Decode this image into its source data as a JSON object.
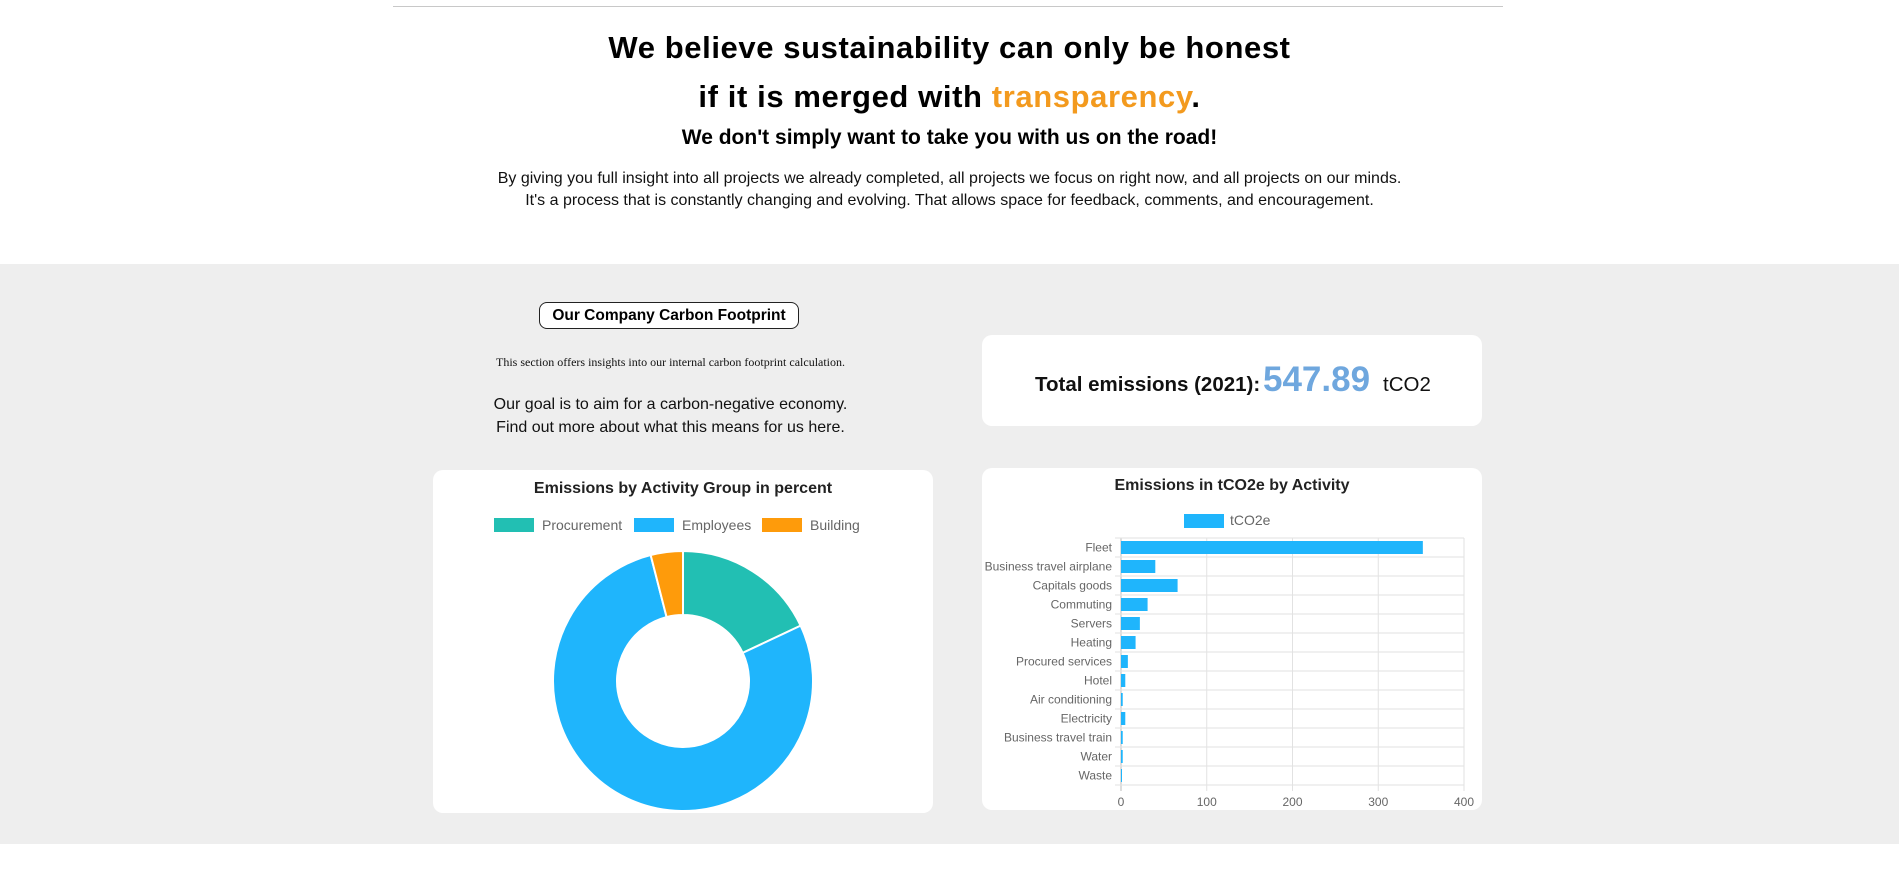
{
  "header": {
    "line1": "We believe sustainability can only be honest",
    "line2_prefix": "if it is merged with ",
    "line2_accent": "transparency",
    "line2_suffix": ".",
    "subhead": "We don't simply want to take you with us on the road!",
    "intro_line1": "By giving you full insight into all projects we already completed, all projects we focus on right now, and all projects on our minds.",
    "intro_line2": "It's a process that is constantly changing and evolving. That allows space for feedback, comments, and encouragement."
  },
  "footprint": {
    "pill_label": "Our Company Carbon Footprint",
    "note": "This section offers insights into our internal carbon footprint calculation.",
    "goal_line1": "Our goal is to aim for a carbon-negative economy.",
    "goal_line2_prefix": "Find out more about what this means for us ",
    "goal_link": "here",
    "goal_line2_suffix": "."
  },
  "total": {
    "label": "Total emissions (2021):",
    "value": "547.89",
    "unit": "tCO2"
  },
  "colors": {
    "accent": "#f39a1e",
    "teal": "#22bfb3",
    "blue": "#1fb5fc",
    "orange": "#fe9b0b",
    "total_value": "#6fa7de"
  },
  "chart_data": [
    {
      "type": "pie",
      "variant": "doughnut",
      "title": "Emissions by Activity Group in percent",
      "categories": [
        "Procurement",
        "Employees",
        "Building"
      ],
      "values": [
        18,
        78,
        4
      ],
      "legend": "top"
    },
    {
      "type": "bar",
      "orientation": "horizontal",
      "title": "Emissions in tCO2e by Activity",
      "legend": "top",
      "series": [
        {
          "name": "tCO2e",
          "values": [
            352,
            40,
            66,
            31,
            22,
            17,
            8,
            5,
            2,
            5,
            2,
            2,
            1
          ]
        }
      ],
      "categories": [
        "Fleet",
        "Business travel airplane",
        "Capitals goods",
        "Commuting",
        "Servers",
        "Heating",
        "Procured services",
        "Hotel",
        "Air conditioning",
        "Electricity",
        "Business travel train",
        "Water",
        "Waste"
      ],
      "xlim": [
        0,
        400
      ],
      "xticks": [
        "0",
        "100",
        "200",
        "300",
        "400"
      ],
      "grid": true
    }
  ]
}
